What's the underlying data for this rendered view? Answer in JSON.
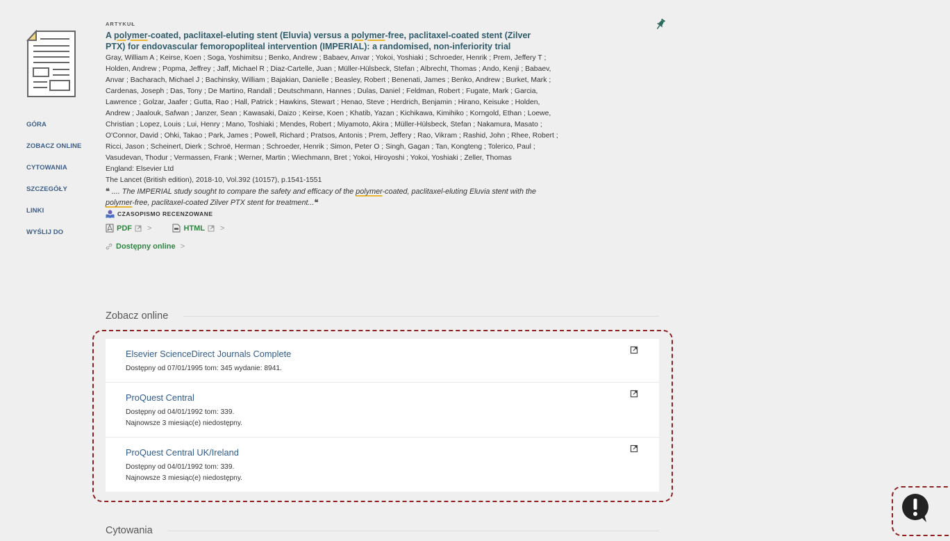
{
  "nav": {
    "items": [
      "GÓRA",
      "ZOBACZ ONLINE",
      "CYTOWANIA",
      "SZCZEGÓŁY",
      "LINKI",
      "WYŚLIJ DO"
    ]
  },
  "record": {
    "type_label": "ARTYKUŁ",
    "title": {
      "p1": "A ",
      "p2": "polymer",
      "p3": "-coated, paclitaxel-eluting stent (Eluvia) versus a ",
      "p4": "polymer",
      "p5": "-free, paclitaxel-coated stent (Zilver",
      "line2": "PTX) for endovascular femoropopliteal intervention (IMPERIAL): a randomised, non-inferiority trial"
    },
    "authors": [
      "Gray, William A ; Keirse, Koen ; Soga, Yoshimitsu ; Benko, Andrew ; Babaev, Anvar ; Yokoi, Yoshiaki ; Schroeder, Henrik ; Prem, Jeffery T ;",
      "Holden, Andrew ; Popma, Jeffrey ; Jaff, Michael R ; Diaz-Cartelle, Juan ; Müller-Hülsbeck, Stefan ; Albrecht, Thomas ; Ando, Kenji ; Babaev,",
      "Anvar ; Bacharach, Michael J ; Bachinsky, William ; Bajakian, Danielle ; Beasley, Robert ; Benenati, James ; Benko, Andrew ; Burket, Mark ;",
      "Cardenas, Joseph ; Das, Tony ; De Martino, Randall ; Deutschmann, Hannes ; Dulas, Daniel ; Feldman, Robert ; Fugate, Mark ; Garcia,",
      "Lawrence ; Golzar, Jaafer ; Gutta, Rao ; Hall, Patrick ; Hawkins, Stewart ; Henao, Steve ; Herdrich, Benjamin ; Hirano, Keisuke ; Holden,",
      "Andrew ; Jaalouk, Safwan ; Janzer, Sean ; Kawasaki, Daizo ; Keirse, Koen ; Khatib, Yazan ; Kichikawa, Kimihiko ; Korngold, Ethan ; Loewe,",
      "Christian ; Lopez, Louis ; Lui, Henry ; Mano, Toshiaki ; Mendes, Robert ; Miyamoto, Akira ; Müller-Hülsbeck, Stefan ; Nakamura, Masato ;",
      "O'Connor, David ; Ohki, Takao ; Park, James ; Powell, Richard ; Pratsos, Antonis ; Prem, Jeffery ; Rao, Vikram ; Rashid, John ; Rhee, Robert ;",
      "Ricci, Jason ; Scheinert, Dierk ; Schroë, Herman ; Schroeder, Henrik ; Simon, Peter O ; Singh, Gagan ; Tan, Kongteng ; Tolerico, Paul ;",
      "Vasudevan, Thodur ; Vermassen, Frank ; Werner, Martin ; Wiechmann, Bret ; Yokoi, Hiroyoshi ; Yokoi, Yoshiaki ; Zeller, Thomas"
    ],
    "publisher": "England: Elsevier Ltd",
    "source": "The Lancet (British edition), 2018-10, Vol.392 (10157), p.1541-1551",
    "snippet": {
      "open_quote": "❝",
      "close_quote": "❝",
      "s1": " .... The IMPERIAL study sought to compare the safety and efficacy of the ",
      "s2": "polymer",
      "s3": "-coated, paclitaxel-eluting Eluvia stent with the",
      "s4": "polymer",
      "s5": "-free, paclitaxel-coated Zilver PTX stent for treatment..."
    },
    "peer_label": "CZASOPISMO RECENZOWANE",
    "links": {
      "pdf": "PDF",
      "html": "HTML",
      "chevron": ">"
    },
    "online_label": "Dostępny online",
    "online_chevron": ">"
  },
  "sections": {
    "view_online": "Zobacz online",
    "citations": "Cytowania"
  },
  "services": [
    {
      "name": "Elsevier ScienceDirect Journals Complete",
      "availability": "Dostępny od 07/01/1995 tom: 345 wydanie: 8941.",
      "note": ""
    },
    {
      "name": "ProQuest Central",
      "availability": "Dostępny od 04/01/1992 tom: 339.",
      "note": "Najnowsze 3 miesiąc(e) niedostępny."
    },
    {
      "name": "ProQuest Central UK/Ireland",
      "availability": "Dostępny od 04/01/1992 tom: 339.",
      "note": "Najnowsze 3 miesiąc(e) niedostępny."
    }
  ],
  "colors": {
    "title": "#2f5b6a",
    "link_green": "#2e8540",
    "service_link": "#2f5b8a",
    "highlight_box": "#8b1f1f",
    "background": "#efefef"
  },
  "icons": [
    "article-document-icon",
    "pin-icon",
    "pdf-icon",
    "html-icon",
    "external-link-icon",
    "link-icon",
    "peer-reviewed-icon",
    "feedback-icon"
  ]
}
